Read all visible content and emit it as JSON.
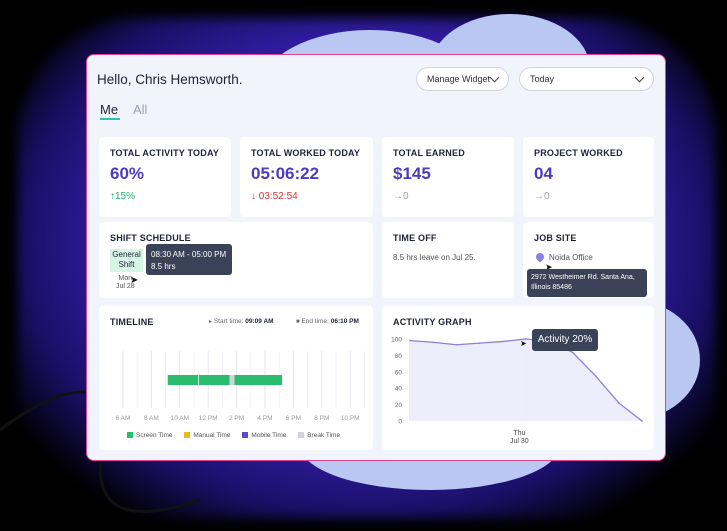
{
  "header": {
    "greeting": "Hello, Chris Hemsworth.",
    "manage_widget": "Manage Widget",
    "range_select": "Today"
  },
  "tabs": [
    {
      "label": "Me",
      "active": true
    },
    {
      "label": "All",
      "active": false
    }
  ],
  "stats": {
    "activity": {
      "title": "TOTAL ACTIVITY TODAY",
      "value": "60%",
      "delta": "15%"
    },
    "worked": {
      "title": "TOTAL WORKED TODAY",
      "value": "05:06:22",
      "delta": "03:52:54"
    },
    "earned": {
      "title": "TOTAL EARNED",
      "value": "$145",
      "delta": "0"
    },
    "project": {
      "title": "PROJECT WORKED",
      "value": "04",
      "delta": "0"
    }
  },
  "shift": {
    "title": "SHIFT SCHEDULE",
    "chip_line1": "General",
    "chip_line2": "Shift",
    "day": "Mon",
    "date": "Jul 28",
    "tooltip_time": "08:30 AM - 05:00 PM",
    "tooltip_hours": "8.5 hrs"
  },
  "timeoff": {
    "title": "TIME OFF",
    "text": "8.5 hrs leave on Jul 25."
  },
  "jobsite": {
    "title": "JOB SITE",
    "location": "Noida Office",
    "address_line1": "2972 Westheimer Rd. Santa Ana,",
    "address_line2": "Illinois 85486"
  },
  "timeline": {
    "title": "TIMELINE",
    "start_label": "Start time:",
    "start_value": "09:09 AM",
    "end_label": "End time:",
    "end_value": "06:10 PM",
    "hours": [
      "6 AM",
      "8 AM",
      "10 AM",
      "12 PM",
      "2 PM",
      "4 PM",
      "6 PM",
      "8 PM",
      "10 PM"
    ],
    "legend": [
      {
        "label": "Screen Time",
        "color": "#2bbd6e"
      },
      {
        "label": "Manual Time",
        "color": "#e8b923"
      },
      {
        "label": "Mobile Time",
        "color": "#5a4bc9"
      },
      {
        "label": "Break Time",
        "color": "#d0d3da"
      }
    ],
    "colors": {
      "screen": "#2bbd6e",
      "break": "#d0d3da"
    }
  },
  "activity_graph": {
    "title": "ACTIVITY GRAPH",
    "tooltip": "Activity 20%",
    "x_day": "Thu",
    "x_date": "Jul 30"
  },
  "chart_data": {
    "type": "line",
    "title": "ACTIVITY GRAPH",
    "ylim": [
      0,
      100
    ],
    "yticks": [
      0,
      20,
      40,
      60,
      80,
      100
    ],
    "x": [
      0,
      10,
      20,
      30,
      40,
      50,
      60,
      70,
      80,
      90,
      100
    ],
    "values": [
      98,
      96,
      93,
      95,
      97,
      100,
      97,
      84,
      55,
      22,
      0
    ],
    "xlabel": "Thu Jul 30",
    "annotation": "Activity 20%",
    "line_color": "#8a80e0"
  }
}
